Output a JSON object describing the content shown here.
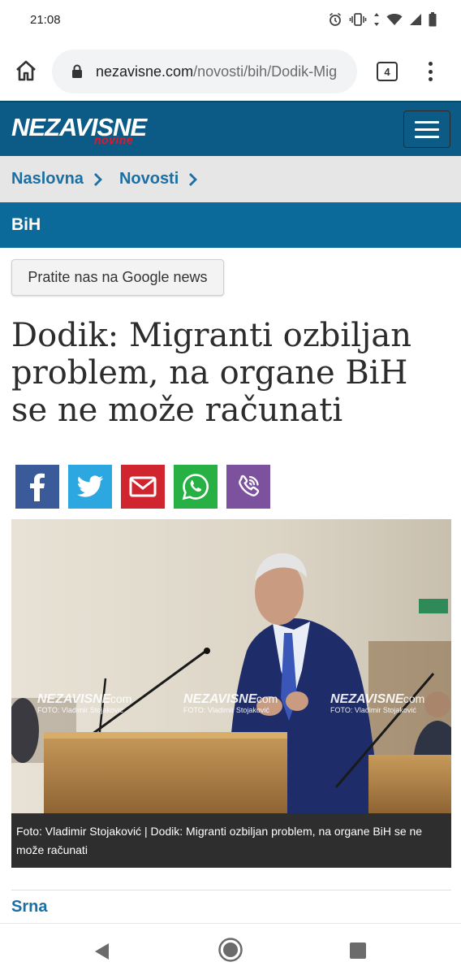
{
  "status_bar": {
    "time": "21:08"
  },
  "browser": {
    "url_domain": "nezavisne.com",
    "url_path": "/novosti/bih/Dodik-Mig",
    "tab_count": "4"
  },
  "site": {
    "logo_main": "NEZAVISNE",
    "logo_sub": "novine",
    "brand_color": "#0c5b86"
  },
  "breadcrumb": {
    "items": [
      "Naslovna",
      "Novosti"
    ],
    "separator": ">"
  },
  "section": {
    "title": "BiH"
  },
  "google_news_button": "Pratite nas na Google news",
  "article": {
    "headline": "Dodik: Migranti ozbiljan problem, na organe BiH se ne može računati",
    "caption": "Foto: Vladimir Stojaković | Dodik: Migranti ozbiljan problem, na organe BiH se ne može računati",
    "author": "Srna"
  },
  "photo": {
    "watermarks": [
      {
        "brand": "NEZAVISNE",
        "domain": ".com",
        "credit": "FOTO: Vladimir Stojaković"
      },
      {
        "brand": "NEZAVISNE",
        "domain": ".com",
        "credit": "FOTO: Vladimir Stojaković"
      },
      {
        "brand": "NEZAVISNE",
        "domain": ".com",
        "credit": "FOTO: Vladimir Stojaković"
      }
    ]
  },
  "social": [
    {
      "name": "facebook-icon",
      "color": "#3b5a9a"
    },
    {
      "name": "twitter-icon",
      "color": "#2ca7e0"
    },
    {
      "name": "gmail-icon",
      "color": "#d0242e"
    },
    {
      "name": "whatsapp-icon",
      "color": "#27b043"
    },
    {
      "name": "viber-icon",
      "color": "#7c529e"
    }
  ]
}
